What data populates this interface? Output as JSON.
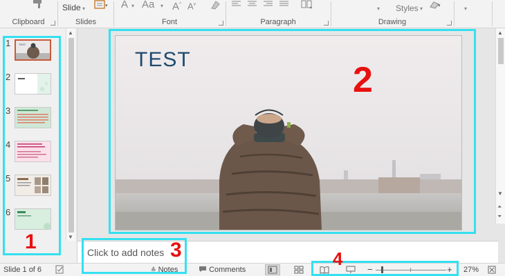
{
  "ribbon": {
    "groups": {
      "clipboard": "Clipboard",
      "slides": "Slides",
      "font": "Font",
      "paragraph": "Paragraph",
      "drawing": "Drawing"
    },
    "slide_button": "Slide",
    "styles_button": "Styles"
  },
  "thumbnails": [
    {
      "num": "1",
      "active": true
    },
    {
      "num": "2",
      "active": false
    },
    {
      "num": "3",
      "active": false
    },
    {
      "num": "4",
      "active": false
    },
    {
      "num": "5",
      "active": false
    },
    {
      "num": "6",
      "active": false
    }
  ],
  "slide": {
    "title": "TEST"
  },
  "notes": {
    "placeholder": "Click to add notes"
  },
  "status": {
    "slide_info": "Slide 1 of 6",
    "notes_button": "Notes",
    "comments_button": "Comments",
    "zoom_level": "27%",
    "zoom_fraction": 0.27
  },
  "annotations": {
    "label_1": "1",
    "label_2": "2",
    "label_3": "3",
    "label_4": "4",
    "highlight_color": "#33e0f0",
    "label_color": "#e81010"
  }
}
